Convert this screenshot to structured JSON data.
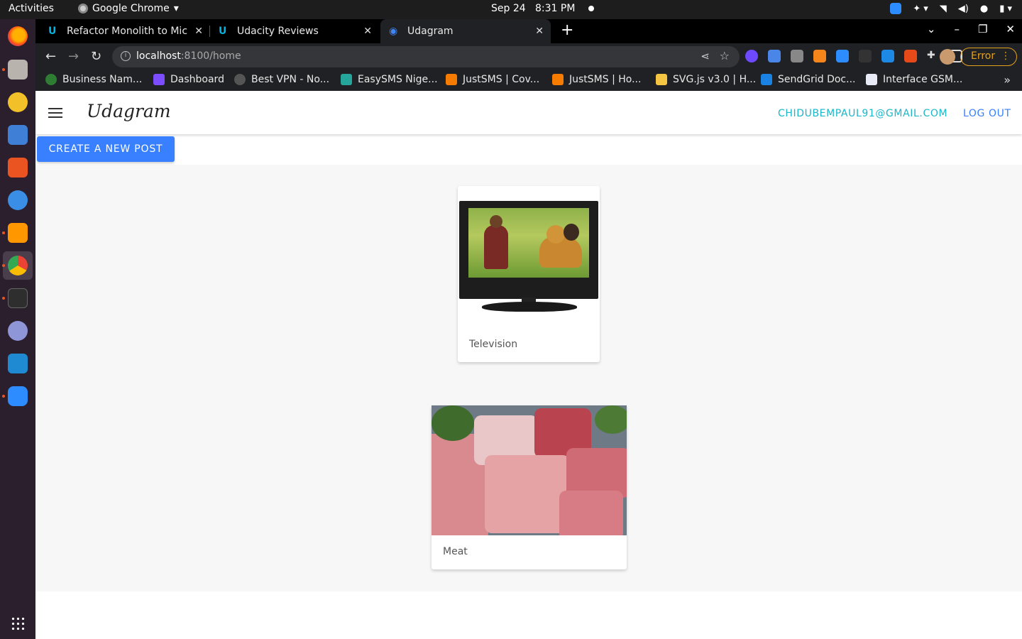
{
  "system_bar": {
    "activities": "Activities",
    "app": "Google Chrome",
    "date": "Sep 24",
    "time": "8:31 PM"
  },
  "browser": {
    "tabs": [
      {
        "title": "Refactor Monolith to Mic"
      },
      {
        "title": "Udacity Reviews"
      },
      {
        "title": "Udagram"
      }
    ],
    "url_host": "localhost",
    "url_rest": ":8100/home",
    "error_label": "Error",
    "bookmarks": [
      {
        "label": "Business Nam..."
      },
      {
        "label": "Dashboard"
      },
      {
        "label": "Best VPN - No..."
      },
      {
        "label": "EasySMS Nige..."
      },
      {
        "label": "JustSMS | Cov..."
      },
      {
        "label": "JustSMS | Ho..."
      },
      {
        "label": "SVG.js v3.0 | H..."
      },
      {
        "label": "SendGrid Doc..."
      },
      {
        "label": "Interface GSM..."
      }
    ]
  },
  "app": {
    "logo": "Udagram",
    "user_email": "CHIDUBEMPAUL91@GMAIL.COM",
    "logout": "LOG OUT",
    "create_post": "CREATE A NEW POST",
    "posts": [
      {
        "caption": "Television"
      },
      {
        "caption": "Meat"
      }
    ]
  },
  "colors": {
    "primary": "#3880ff",
    "email": "#1bb6c9",
    "error": "#e4a11b"
  }
}
